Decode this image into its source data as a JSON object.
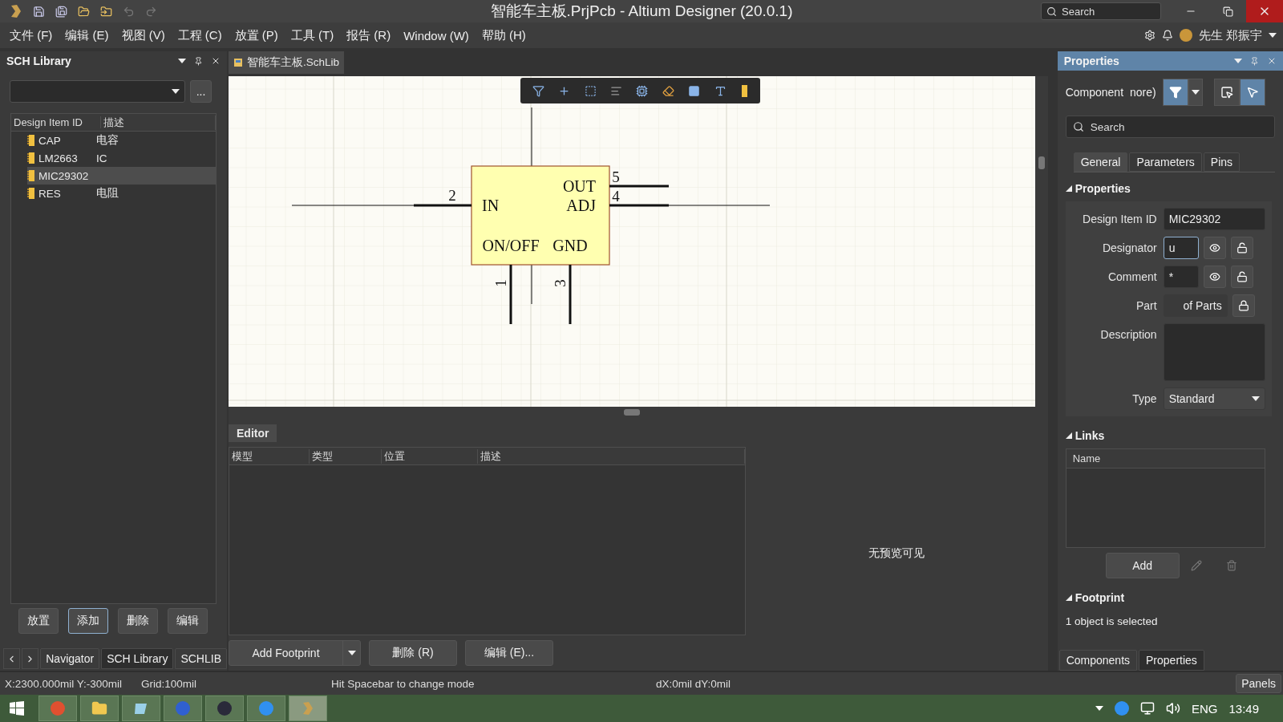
{
  "window": {
    "title": "智能车主板.PrjPcb - Altium Designer (20.0.1)",
    "search_placeholder": "Search"
  },
  "menu": [
    "文件 (F)",
    "编辑 (E)",
    "视图 (V)",
    "工程 (C)",
    "放置 (P)",
    "工具 (T)",
    "报告 (R)",
    "Window (W)",
    "帮助 (H)"
  ],
  "user": {
    "name": "先生 郑振宇"
  },
  "sch_library": {
    "title": "SCH Library",
    "browse": "...",
    "columns": [
      "Design Item ID",
      "描述"
    ],
    "rows": [
      {
        "id": "CAP",
        "description": "电容",
        "selected": false
      },
      {
        "id": "LM2663",
        "description": "IC",
        "selected": false
      },
      {
        "id": "MIC29302",
        "selected": true
      },
      {
        "id": "RES",
        "description": "电阻",
        "selected": false
      }
    ],
    "buttons": [
      {
        "label": "放置",
        "focused": false
      },
      {
        "label": "添加",
        "focused": true
      },
      {
        "label": "删除",
        "focused": false
      },
      {
        "label": "编辑",
        "focused": false
      }
    ],
    "tabs": [
      {
        "label": "Navigator",
        "selected": false
      },
      {
        "label": "SCH Library",
        "selected": true
      },
      {
        "label": "SCHLIB",
        "selected": false
      }
    ]
  },
  "document_tab": {
    "label": "智能车主板.SchLib",
    "selected": true
  },
  "component": {
    "pins": [
      {
        "number": "2",
        "name": "IN",
        "kind": "left"
      },
      {
        "number": "5",
        "name": "OUT",
        "kind": "right"
      },
      {
        "number": "4",
        "name": "ADJ",
        "kind": "right"
      },
      {
        "number": "1",
        "name": "ON/OFF",
        "kind": "bottom"
      },
      {
        "number": "3",
        "name": "GND",
        "kind": "bottom"
      }
    ]
  },
  "editor": {
    "title": "Editor",
    "columns": [
      "模型",
      "类型",
      "位置",
      "描述"
    ],
    "preview": "无预览可见",
    "buttons": [
      "Add Footprint",
      "删除 (R)",
      "编辑 (E)..."
    ]
  },
  "properties": {
    "title": "Properties",
    "filter_label": "Component",
    "filter_more": "nore)",
    "search_placeholder": "Search",
    "tabs": [
      {
        "label": "General",
        "selected": true
      },
      {
        "label": "Parameters",
        "selected": false
      },
      {
        "label": "Pins",
        "selected": false
      }
    ],
    "section": "Properties",
    "fields": [
      {
        "label": "Design Item ID",
        "kind": "text",
        "value": "MIC29302",
        "focused": false
      },
      {
        "label": "Designator",
        "kind": "toggle",
        "value": "u",
        "focused": true
      },
      {
        "label": "Comment",
        "kind": "toggle",
        "value": "*",
        "focused": false
      },
      {
        "label": "Part",
        "kind": "part",
        "value": "of Parts",
        "focused": false
      },
      {
        "label": "Description",
        "kind": "area",
        "focused": false
      },
      {
        "label": "Type",
        "kind": "select",
        "value": "Standard",
        "focused": false
      }
    ],
    "links": {
      "title": "Links",
      "columns": [
        "Name"
      ],
      "add": "Add"
    },
    "footprint": {
      "title": "Footprint"
    },
    "selection": "1 object is selected",
    "bottom_tabs": [
      {
        "label": "Components",
        "selected": false
      },
      {
        "label": "Properties",
        "selected": true
      }
    ]
  },
  "status_bar": {
    "position": "X:2300.000mil Y:-300mil",
    "grid": "Grid:100mil",
    "hint": "Hit Spacebar to change mode",
    "delta": "dX:0mil dY:0mil",
    "panels": "Panels"
  },
  "taskbar": {
    "language": "ENG",
    "time": "13:49"
  }
}
